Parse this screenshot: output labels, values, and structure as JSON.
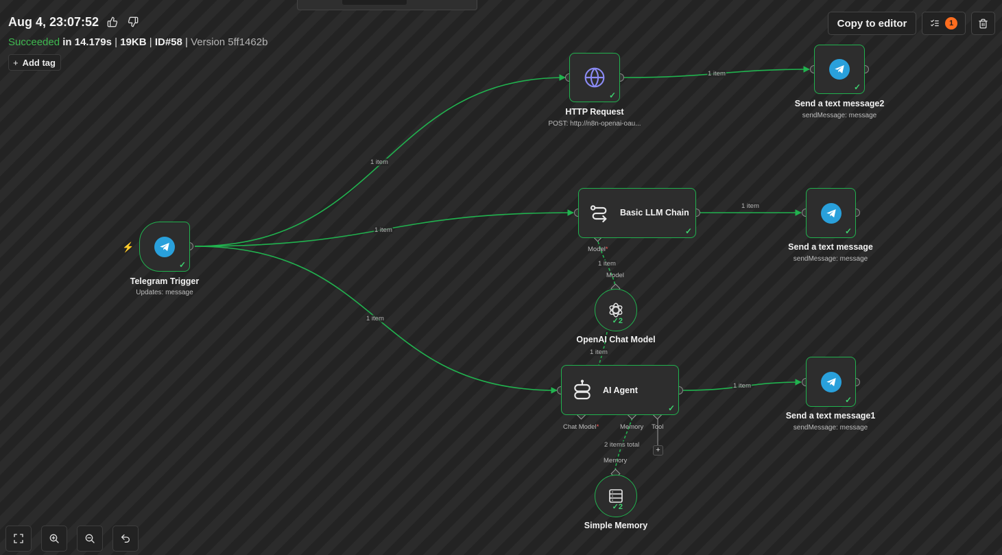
{
  "execution": {
    "title": "Aug 4, 23:07:52",
    "status": "Succeeded",
    "duration": "in 14.179s",
    "size": "19KB",
    "id": "ID#58",
    "version": "Version 5ff1462b",
    "separator": "|"
  },
  "toolbar": {
    "add_tag_plus": "+",
    "add_tag": "Add tag",
    "copy_to_editor": "Copy to editor",
    "issues_count": "1"
  },
  "nodes": {
    "telegram_trigger": {
      "label": "Telegram Trigger",
      "sub": "Updates: message"
    },
    "http_request": {
      "label": "HTTP Request",
      "sub": "POST: http://n8n-openai-oau..."
    },
    "send_message2": {
      "label": "Send a text message2",
      "sub": "sendMessage: message"
    },
    "llm_chain": {
      "label": "Basic LLM Chain",
      "port_model": "Model"
    },
    "send_message": {
      "label": "Send a text message",
      "sub": "sendMessage: message"
    },
    "openai_model": {
      "label": "OpenAI Chat Model",
      "port_model": "Model",
      "runs": "2"
    },
    "ai_agent": {
      "label": "AI Agent",
      "port_chat_model": "Chat Model",
      "port_memory": "Memory",
      "port_tool": "Tool"
    },
    "send_message1": {
      "label": "Send a text message1",
      "sub": "sendMessage: message"
    },
    "simple_memory": {
      "label": "Simple Memory",
      "port_memory": "Memory",
      "runs": "2"
    }
  },
  "edges": {
    "trigger_http": "1 item",
    "http_send2": "1 item",
    "trigger_chain": "1 item",
    "chain_send": "1 item",
    "model_chain": "1 item",
    "trigger_agent": "1 item",
    "model_agent": "1 item",
    "agent_send1": "1 item",
    "memory_agent": "2 items total"
  },
  "icons": {
    "like": "thumbs-up-icon",
    "dislike": "thumbs-down-icon",
    "issues": "checklist-icon",
    "delete": "trash-icon",
    "fit": "fit-view-icon",
    "zoom_in": "zoom-in-icon",
    "zoom_out": "zoom-out-icon",
    "reset": "reset-zoom-icon"
  },
  "colors": {
    "success": "#3fb950",
    "edge": "#21b34f",
    "telegram": "#29a0db",
    "badge": "#ff6d1f"
  }
}
